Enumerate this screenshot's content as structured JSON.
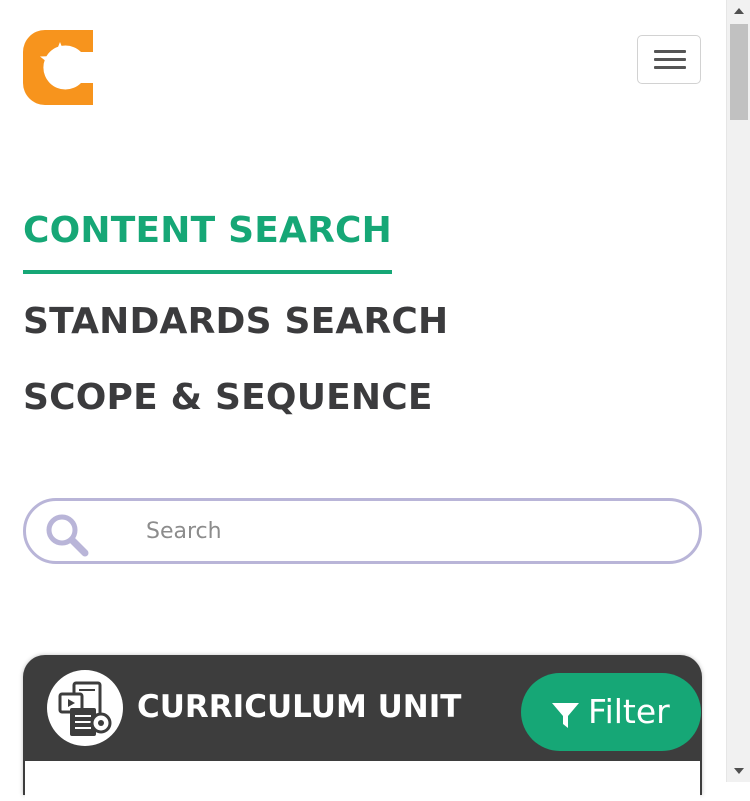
{
  "header": {
    "logo_icon": "star-c-logo-icon",
    "brand_color": "#f7941d",
    "menu_icon": "hamburger-icon"
  },
  "nav": {
    "items": [
      {
        "label": "CONTENT SEARCH",
        "active": true
      },
      {
        "label": "STANDARDS SEARCH",
        "active": false
      },
      {
        "label": "SCOPE & SEQUENCE",
        "active": false
      }
    ],
    "active_color": "#16a776",
    "text_color": "#3b3b3d"
  },
  "search": {
    "placeholder": "Search",
    "value": "",
    "icon": "search-icon",
    "border_color": "#b9b5d8"
  },
  "result_card": {
    "title": "CURRICULUM UNIT",
    "icon": "curriculum-unit-icon",
    "background": "#3d3d3d",
    "filter_label": "Filter",
    "filter_icon": "funnel-icon",
    "filter_color": "#16a776"
  }
}
